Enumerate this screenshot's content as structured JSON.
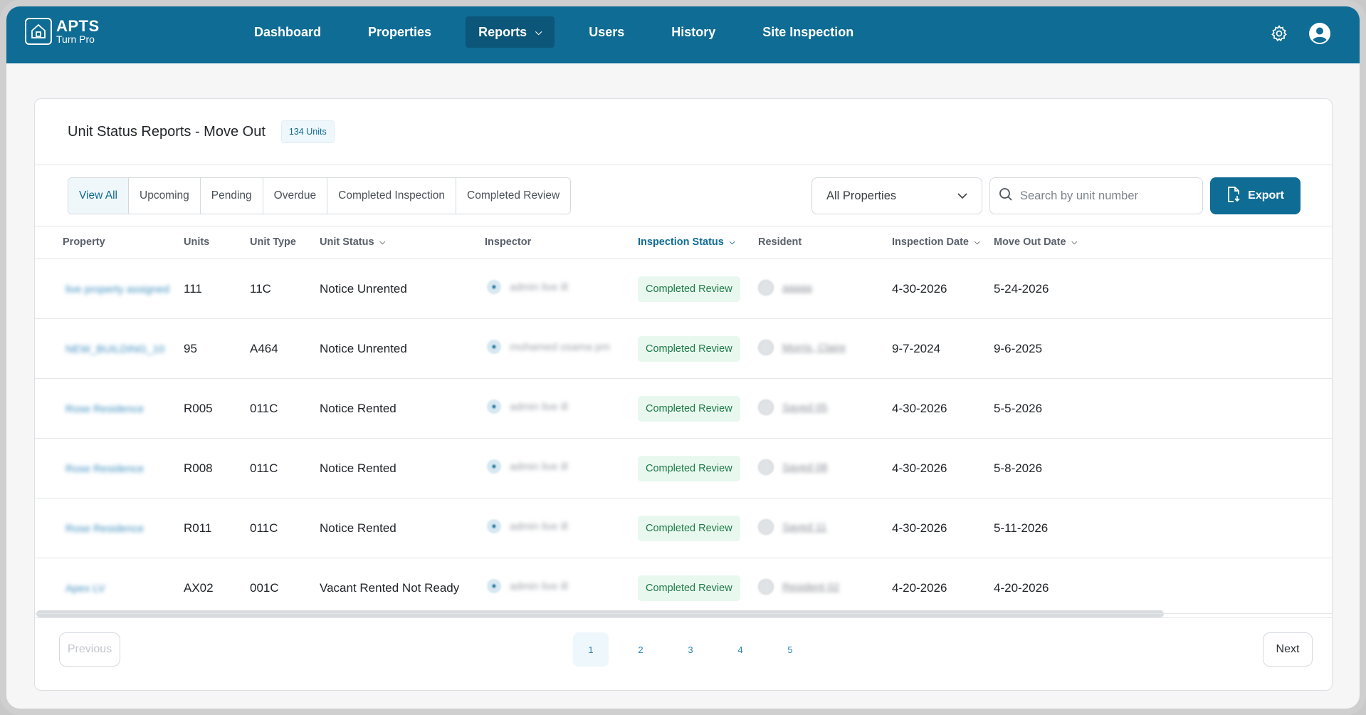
{
  "app": {
    "logo_title": "APTS",
    "logo_subtitle": "Turn Pro",
    "nav": [
      {
        "label": "Dashboard"
      },
      {
        "label": "Properties"
      },
      {
        "label": "Reports"
      },
      {
        "label": "Users"
      },
      {
        "label": "History"
      },
      {
        "label": "Site Inspection"
      }
    ],
    "active_nav": "Reports"
  },
  "report": {
    "title": "Unit Status Reports - Move Out",
    "units_badge": "134 Units",
    "filters": [
      "View All",
      "Upcoming",
      "Pending",
      "Overdue",
      "Completed Inspection",
      "Completed Review"
    ],
    "active_filter": "View All",
    "property_select": "All Properties",
    "search_placeholder": "Search by unit number",
    "export_label": "Export"
  },
  "table": {
    "columns": [
      "Property",
      "Units",
      "Unit Type",
      "Unit Status",
      "Inspector",
      "Inspection Status",
      "Resident",
      "Inspection Date",
      "Move Out Date"
    ],
    "rows": [
      {
        "property": "live property assigned",
        "unit": "111",
        "unit_type": "11C",
        "unit_status": "Notice Unrented",
        "inspector": "admin live ill",
        "inspection_status": "Completed Review",
        "resident": "aaaaa",
        "inspection_date": "4-30-2026",
        "move_out_date": "5-24-2026"
      },
      {
        "property": "NEW_BUILDING_10",
        "unit": "95",
        "unit_type": "A464",
        "unit_status": "Notice Unrented",
        "inspector": "mohamed osama pm",
        "inspection_status": "Completed Review",
        "resident": "Morris, Claire",
        "inspection_date": "9-7-2024",
        "move_out_date": "9-6-2025"
      },
      {
        "property": "Rose Residence",
        "unit": "R005",
        "unit_type": "011C",
        "unit_status": "Notice Rented",
        "inspector": "admin live ill",
        "inspection_status": "Completed Review",
        "resident": "Sayed 05",
        "inspection_date": "4-30-2026",
        "move_out_date": "5-5-2026"
      },
      {
        "property": "Rose Residence",
        "unit": "R008",
        "unit_type": "011C",
        "unit_status": "Notice Rented",
        "inspector": "admin live ill",
        "inspection_status": "Completed Review",
        "resident": "Sayed 08",
        "inspection_date": "4-30-2026",
        "move_out_date": "5-8-2026"
      },
      {
        "property": "Rose Residence",
        "unit": "R011",
        "unit_type": "011C",
        "unit_status": "Notice Rented",
        "inspector": "admin live ill",
        "inspection_status": "Completed Review",
        "resident": "Sayed 11",
        "inspection_date": "4-30-2026",
        "move_out_date": "5-11-2026"
      },
      {
        "property": "Apex LV",
        "unit": "AX02",
        "unit_type": "001C",
        "unit_status": "Vacant Rented Not Ready",
        "inspector": "admin live ill",
        "inspection_status": "Completed Review",
        "resident": "Resident 02",
        "inspection_date": "4-20-2026",
        "move_out_date": "4-20-2026"
      }
    ]
  },
  "pagination": {
    "previous_label": "Previous",
    "next_label": "Next",
    "pages": [
      "1",
      "2",
      "3",
      "4",
      "5"
    ],
    "current_page": "1"
  },
  "colors": {
    "brand": "#0f6c95",
    "status_success_bg": "#e9f8ef",
    "status_success_text": "#1d7a46"
  }
}
